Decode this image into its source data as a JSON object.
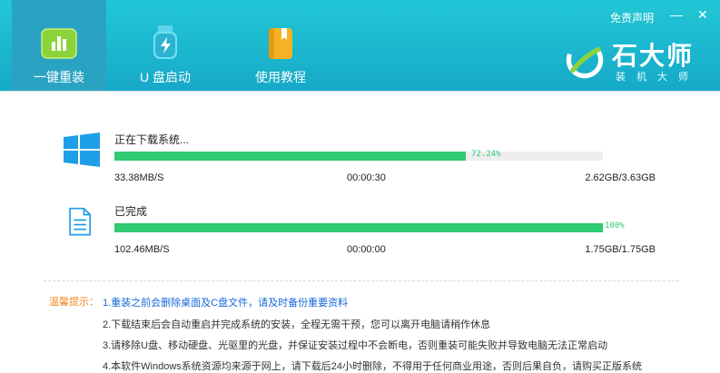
{
  "nav": [
    {
      "label": "一键重装"
    },
    {
      "label": "U 盘启动"
    },
    {
      "label": "使用教程"
    }
  ],
  "top": {
    "disclaimer": "免责声明",
    "minimize": "—",
    "close": "✕"
  },
  "brand": {
    "name": "石大师",
    "sub": "装机大师"
  },
  "tasks": [
    {
      "title": "正在下载系统...",
      "progress_percent": 72.24,
      "percent_label": "72.24%",
      "speed": "33.38MB/S",
      "time": "00:00:30",
      "size": "2.62GB/3.63GB",
      "icon": "windows-icon"
    },
    {
      "title": "已完成",
      "progress_percent": 100,
      "percent_label": "100%",
      "speed": "102.46MB/S",
      "time": "00:00:00",
      "size": "1.75GB/1.75GB",
      "icon": "document-icon"
    }
  ],
  "tips": {
    "label": "温馨提示：",
    "items": [
      "1.重装之前会删除桌面及C盘文件，请及时备份重要资料",
      "2.下载结束后会自动重启并完成系统的安装，全程无需干预，您可以离开电脑请稍作休息",
      "3.请移除U盘、移动硬盘、光驱里的光盘，并保证安装过程中不会断电，否则重装可能失败并导致电脑无法正常启动",
      "4.本软件Windows系统资源均来源于网上，请下载后24小时删除，不得用于任何商业用途，否则后果自负，请购买正版系统"
    ]
  },
  "colors": {
    "header": "#1bb9cf",
    "progress": "#2ecb71",
    "tip_label": "#f08a23",
    "tip_first": "#1668d8"
  }
}
